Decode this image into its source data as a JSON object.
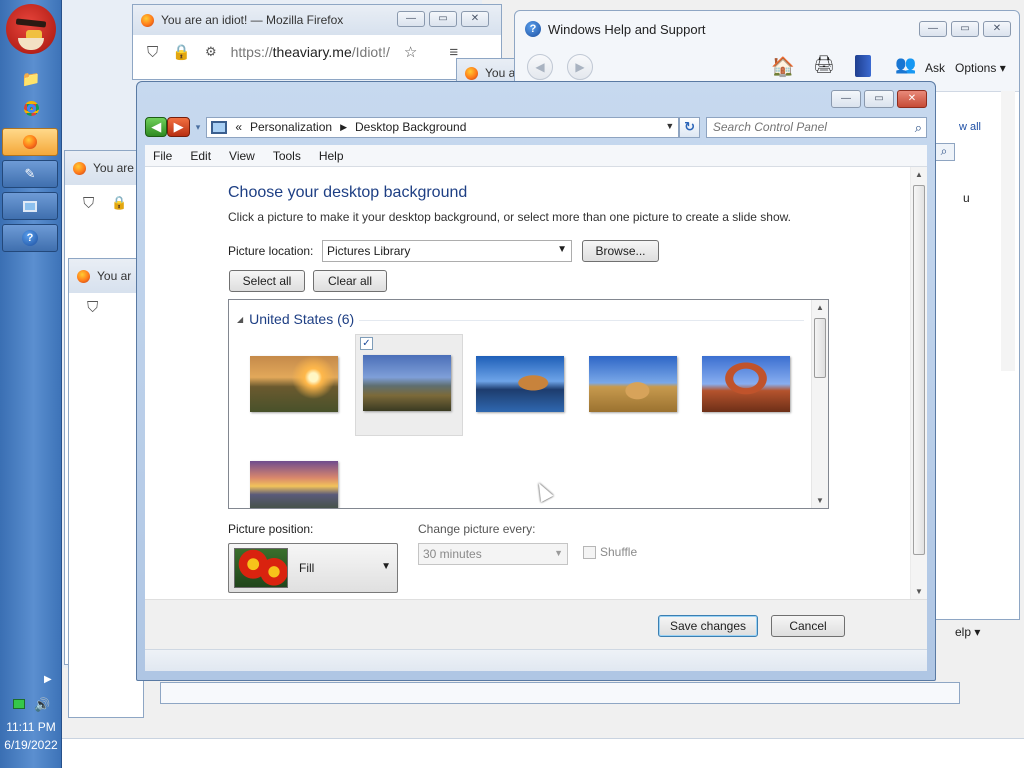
{
  "taskbar": {
    "time": "11:11 PM",
    "date": "6/19/2022"
  },
  "bg_windows": {
    "firefox_title": "You are an idiot! — Mozilla Firefox",
    "firefox_url_prefix": "https://",
    "firefox_url_host": "theaviary.me",
    "firefox_url_path": "/Idiot!/",
    "small_tab_title_1": "You a",
    "small_tab_title_2": "You are",
    "small_tab_title_3": "You ar",
    "help_right_link": "w all",
    "help_side_text": "u",
    "help_bottom_link": "elp ▾"
  },
  "help": {
    "title": "Windows Help and Support",
    "ask_label": "Ask",
    "options_label": "Options"
  },
  "dialog": {
    "address": {
      "crumb_prefix": "«",
      "crumb_1": "Personalization",
      "crumb_2": "Desktop Background"
    },
    "search_placeholder": "Search Control Panel",
    "menu": [
      "File",
      "Edit",
      "View",
      "Tools",
      "Help"
    ],
    "heading": "Choose your desktop background",
    "description": "Click a picture to make it your desktop background, or select more than one picture to create a slide show.",
    "picture_location_label": "Picture location:",
    "picture_location_value": "Pictures Library",
    "browse_label": "Browse...",
    "select_all_label": "Select all",
    "clear_all_label": "Clear all",
    "group_title": "United States (6)",
    "picture_position_label": "Picture position:",
    "picture_position_value": "Fill",
    "change_every_label": "Change picture every:",
    "change_every_value": "30 minutes",
    "shuffle_label": "Shuffle",
    "save_label": "Save changes",
    "cancel_label": "Cancel"
  },
  "colors": {
    "heading": "#1e3f84",
    "frame": "#afc6e4",
    "accent_primary_button": "#3c7fb1"
  }
}
